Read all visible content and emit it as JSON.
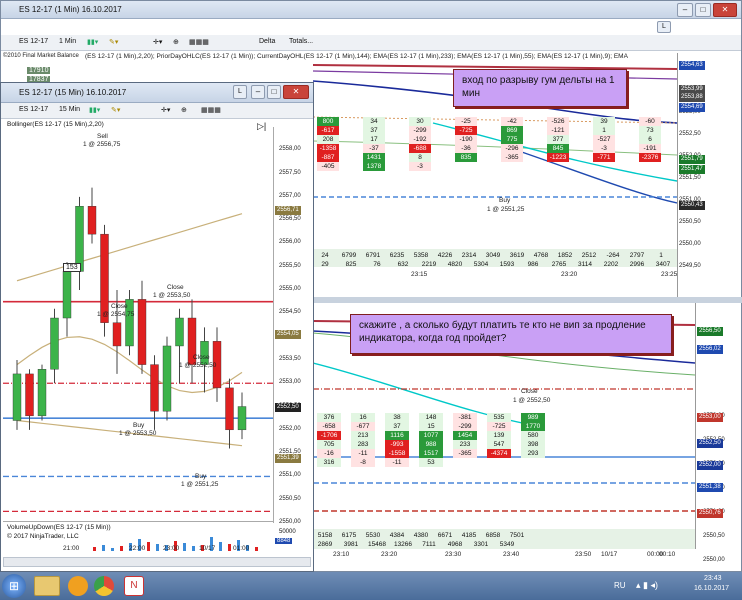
{
  "colors": {
    "up": "#3cb34a",
    "down": "#e02020",
    "sma": "#c8b07a",
    "red_line": "#d42a3a",
    "blue_line": "#4a86d8",
    "teal": "#00c8c8",
    "navy": "#1a2a9a"
  },
  "main_window": {
    "title": "ES 12-17 (1 Min) 16.10.2017",
    "toolbar": {
      "instrument": "ES 12-17",
      "interval": "1 Min",
      "delta": "Delta",
      "totals": "Totals..."
    },
    "indicator_line": "(ES 12-17 (1 Min),2,20); PriorDayOHLC(ES 12-17 (1 Min)); CurrentDayOHL(ES 12-17 (1 Min),144); EMA(ES 12-17 (1 Min),233); EMA(ES 12-17 (1 Min),55); EMA(ES 12-17 (1 Min),9); EMA",
    "market_balance": "©2010 Final Market Balance",
    "mb_values": [
      "17910",
      "17837"
    ],
    "price_ticks": [
      "2554,00",
      "2553,50",
      "2553,00",
      "2552,50",
      "2552,00",
      "2551,50",
      "2551,00",
      "2550,50",
      "2550,00",
      "2549,50"
    ],
    "price_tags": [
      {
        "text": "2553,99",
        "color": "#4a4a4a"
      },
      {
        "text": "2553,88",
        "color": "#4a4a4a"
      },
      {
        "text": "2554,69",
        "color": "#1f4ab0"
      },
      {
        "text": "2551,79",
        "color": "#1a7a2a"
      },
      {
        "text": "2551,47",
        "color": "#1a7a2a"
      },
      {
        "text": "2550,43",
        "color": "#2a2a2a"
      },
      {
        "text": "2554,63",
        "color": "#1f4ab0"
      }
    ],
    "time_labels": [
      "23:15",
      "23:20",
      "23:25"
    ],
    "volume_row1": [
      "24",
      "6799",
      "6791",
      "6235",
      "5358",
      "4226",
      "2314",
      "3049",
      "3619",
      "4768",
      "1852",
      "2512",
      "-264",
      "2797",
      "1"
    ],
    "volume_row2": [
      "29",
      "825",
      "76",
      "632",
      "2219",
      "4820",
      "5304",
      "1593",
      "986",
      "2765",
      "3114",
      "2202",
      "2996",
      "3407"
    ],
    "buy_label": "Buy",
    "buy_price": "1 @ 2551,25",
    "note": "вход по разрыву гум дельты на 1 мин"
  },
  "second_window": {
    "price_ticks": [
      "2553,00",
      "2552,50",
      "2552,00",
      "2551,50",
      "2551,00",
      "2550,50",
      "2550,00"
    ],
    "price_tags": [
      {
        "text": "2556,50",
        "color": "#1a7a2a"
      },
      {
        "text": "2556,02",
        "color": "#1f4ab0"
      },
      {
        "text": "2553,00",
        "color": "#c0362c"
      },
      {
        "text": "2552,50",
        "color": "#1a3a9a"
      },
      {
        "text": "2552,00",
        "color": "#1a3a9a"
      },
      {
        "text": "2551,38",
        "color": "#1f4ab0"
      },
      {
        "text": "2550,76",
        "color": "#c0362c"
      }
    ],
    "time_labels": [
      "23:10",
      "23:20",
      "23:30",
      "23:40",
      "23:50",
      "00:00",
      "10/17",
      "00:10"
    ],
    "close_label": "Close",
    "close_price": "1 @ 2552,50",
    "volume_row1": [
      "5158",
      "6175",
      "5530",
      "4384",
      "4380",
      "6671",
      "4185",
      "6858",
      "7501"
    ],
    "volume_row2": [
      "2869",
      "3981",
      "15468",
      "13266",
      "7111",
      "4968",
      "3301",
      "5349"
    ],
    "note": "скажите , а сколько будут платить те кто не вип за продление индикатора, когда год пройдет?"
  },
  "chart_window": {
    "title": "ES 12-17 (15 Min) 16.10.2017",
    "toolbar": {
      "instrument": "ES 12-17",
      "interval": "15 Min"
    },
    "indicator": "Bollinger(ES 12-17 (15 Min),2,20)",
    "volume_indicator": "VolumeUpDown(ES 12-17 (15 Min))",
    "copyright": "© 2017 NinjaTrader, LLC",
    "volume_scale": "50000",
    "volume_tag": "8848",
    "price_ticks": [
      "2558,00",
      "2557,50",
      "2557,00",
      "2556,50",
      "2556,00",
      "2555,50",
      "2555,00",
      "2554,50",
      "2554,00",
      "2553,50",
      "2553,00",
      "2552,50",
      "2552,00",
      "2551,50",
      "2551,00",
      "2550,50",
      "2550,00"
    ],
    "price_tags": [
      {
        "text": "2556,71",
        "color": "#8a7a40"
      },
      {
        "text": "2554,05",
        "color": "#8a7a40"
      },
      {
        "text": "2552,50",
        "color": "#222"
      },
      {
        "text": "2551,39",
        "color": "#8a7a40"
      }
    ],
    "time_labels": [
      "21:00",
      "22:00",
      "23:00",
      "10/17",
      "01:00"
    ],
    "bar_count": "153",
    "executions": [
      {
        "kind": "Sell",
        "price": "1 @ 2556,75"
      },
      {
        "kind": "Close",
        "price": "1 @ 2553,50"
      },
      {
        "kind": "Close",
        "price": "1 @ 2554,75"
      },
      {
        "kind": "Close",
        "price": "1 @ 2552,50"
      },
      {
        "kind": "Buy",
        "price": "1 @ 2553,50"
      },
      {
        "kind": "Buy",
        "price": "1 @ 2551,25"
      }
    ]
  },
  "footprint": {
    "top_cells": [
      "800",
      "34",
      "30",
      "-25",
      "-42",
      "-526",
      "39",
      "-60",
      "-617",
      "37",
      "-299",
      "-725",
      "869",
      "-121",
      "1",
      "73",
      "208",
      "17",
      "-192",
      "-190",
      "775",
      "377",
      "-527",
      "6",
      "-1358",
      "-37",
      "-688",
      "-36",
      "-296",
      "845",
      "-3",
      "-191",
      "-887",
      "1431",
      "8",
      "835",
      "-365",
      "-1223",
      "-771",
      "-2376",
      "-405",
      "1378",
      "-3"
    ],
    "bottom_cells": [
      "376",
      "16",
      "38",
      "148",
      "-381",
      "535",
      "989",
      "-658",
      "-677",
      "37",
      "15",
      "-299",
      "-725",
      "1770",
      "-1706",
      "213",
      "1116",
      "1077",
      "1454",
      "139",
      "580",
      "705",
      "283",
      "-993",
      "988",
      "233",
      "547",
      "398",
      "-16",
      "-11",
      "-1558",
      "1517",
      "-365",
      "-4374",
      "293",
      "316",
      "-8",
      "-11",
      "53"
    ]
  },
  "taskbar": {
    "lang": "RU",
    "time": "23:43",
    "date": "16.10.2017"
  }
}
